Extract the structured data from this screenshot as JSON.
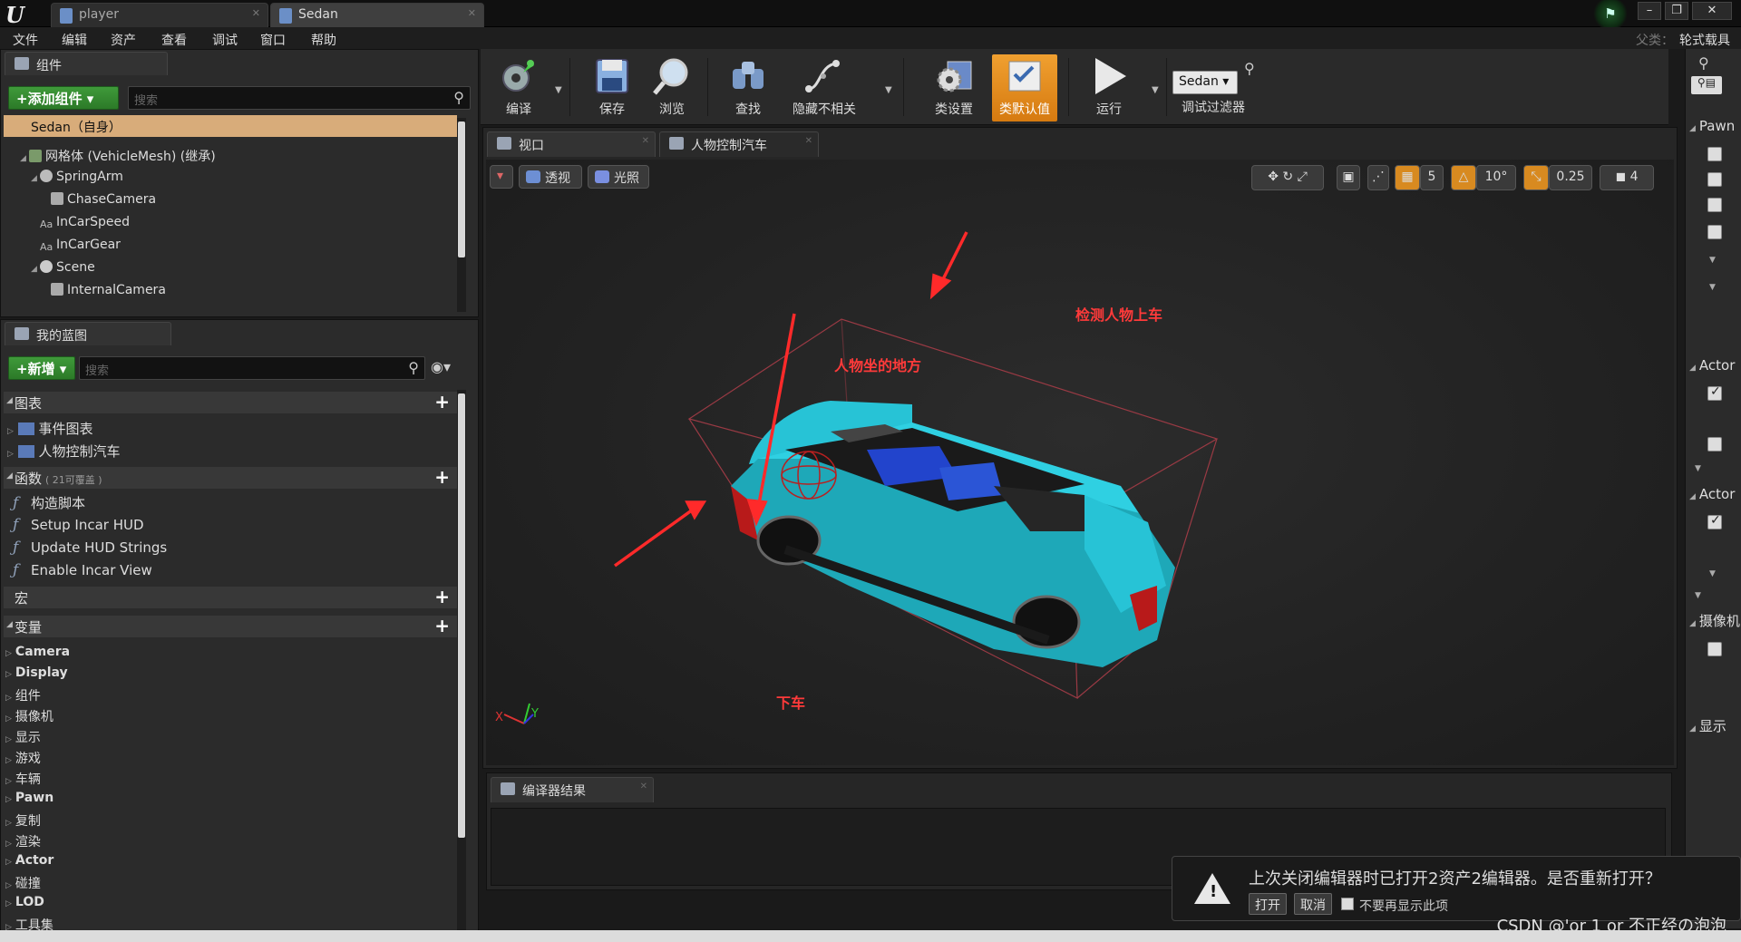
{
  "tabs": [
    {
      "label": "player"
    },
    {
      "label": "Sedan"
    }
  ],
  "window_buttons": {
    "min": "–",
    "max": "❐",
    "close": "✕"
  },
  "menu": [
    "文件",
    "编辑",
    "资产",
    "查看",
    "调试",
    "窗口",
    "帮助"
  ],
  "parent_class": {
    "label": "父类：",
    "value": "轮式载具"
  },
  "components": {
    "tab": "组件",
    "add_button": "+添加组件",
    "search_placeholder": "搜索",
    "root": "Sedan（自身）",
    "tree": [
      {
        "label": "网格体 (VehicleMesh) (继承)"
      },
      {
        "label": "SpringArm"
      },
      {
        "label": "ChaseCamera"
      },
      {
        "label": "InCarSpeed"
      },
      {
        "label": "InCarGear"
      },
      {
        "label": "Scene"
      },
      {
        "label": "InternalCamera"
      }
    ]
  },
  "my_blueprint": {
    "tab": "我的蓝图",
    "add_button": "+新增",
    "search_placeholder": "搜索",
    "graphs": {
      "header": "图表",
      "items": [
        "事件图表",
        "人物控制汽车"
      ]
    },
    "functions": {
      "header": "函数",
      "sub": "( 21可覆盖 )",
      "items": [
        "构造脚本",
        "Setup Incar HUD",
        "Update HUD Strings",
        "Enable Incar View"
      ]
    },
    "macros": {
      "header": "宏"
    },
    "variables": {
      "header": "变量",
      "items": [
        "Camera",
        "Display",
        "组件",
        "摄像机",
        "显示",
        "游戏",
        "车辆",
        "Pawn",
        "复制",
        "渲染",
        "Actor",
        "碰撞",
        "LOD",
        "工具集"
      ]
    }
  },
  "toolbar": {
    "compile": "编译",
    "save": "保存",
    "browse": "浏览",
    "find": "查找",
    "hide_unrelated": "隐藏不相关",
    "class_settings": "类设置",
    "class_defaults": "类默认值",
    "run": "运行",
    "debug_object": "Sedan",
    "debug_filter": "调试过滤器"
  },
  "viewport": {
    "tabs": [
      "视口",
      "人物控制汽车"
    ],
    "perspective": "透视",
    "lit": "光照",
    "grid_snap": "5",
    "rot_snap": "10°",
    "scale_snap": "0.25",
    "cam_speed": "4",
    "axis_x": "X",
    "axis_y": "Y",
    "annotations": {
      "detect": "检测人物上车",
      "seat": "人物坐的地方",
      "exit": "下车"
    }
  },
  "compiler": {
    "tab": "编译器结果"
  },
  "details": {
    "headers": [
      "Pawn",
      "Actor",
      "Actor",
      "摄像机",
      "显示"
    ]
  },
  "toast": {
    "message": "上次关闭编辑器时已打开2资产2编辑器。是否重新打开？",
    "open": "打开",
    "cancel": "取消",
    "dont_show": "不要再显示此项"
  },
  "watermark": "CSDN @'or 1 or 不正经の泡泡",
  "colors": {
    "accent_orange": "#d67a10",
    "green_button": "#2c7a28",
    "selection": "#d8ac7a",
    "annotation_red": "#ff3a3a",
    "car_body": "#27c3d6"
  }
}
